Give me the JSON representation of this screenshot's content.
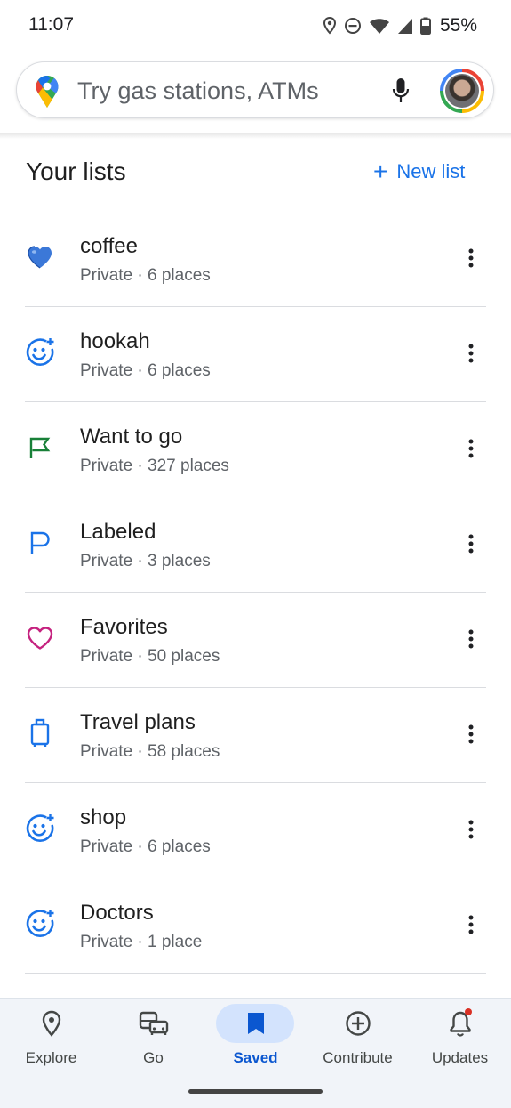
{
  "status": {
    "time": "11:07",
    "battery": "55%"
  },
  "search": {
    "placeholder": "Try gas stations, ATMs"
  },
  "lists_header": {
    "title": "Your lists",
    "new_list_label": "New list"
  },
  "lists": [
    {
      "name": "coffee",
      "meta": "Private · 6 places",
      "icon": "blue-heart-emoji",
      "color": "#1a73e8"
    },
    {
      "name": "hookah",
      "meta": "Private · 6 places",
      "icon": "smiley-add-icon",
      "color": "#1a73e8"
    },
    {
      "name": "Want to go",
      "meta": "Private · 327 places",
      "icon": "flag-icon",
      "color": "#188038"
    },
    {
      "name": "Labeled",
      "meta": "Private · 3 places",
      "icon": "label-flag-icon",
      "color": "#1a73e8"
    },
    {
      "name": "Favorites",
      "meta": "Private · 50 places",
      "icon": "heart-outline-icon",
      "color": "#c5227f"
    },
    {
      "name": "Travel plans",
      "meta": "Private · 58 places",
      "icon": "suitcase-icon",
      "color": "#1a73e8"
    },
    {
      "name": "shop",
      "meta": "Private · 6 places",
      "icon": "smiley-add-icon",
      "color": "#1a73e8"
    },
    {
      "name": "Doctors",
      "meta": "Private · 1 place",
      "icon": "smiley-add-icon",
      "color": "#1a73e8"
    }
  ],
  "nav": {
    "explore": "Explore",
    "go": "Go",
    "saved": "Saved",
    "contribute": "Contribute",
    "updates": "Updates",
    "active": "Saved"
  },
  "colors": {
    "accent": "#1a73e8",
    "nav_active": "#0b57d0",
    "nav_pill": "#d3e3fd",
    "badge": "#d93025"
  }
}
